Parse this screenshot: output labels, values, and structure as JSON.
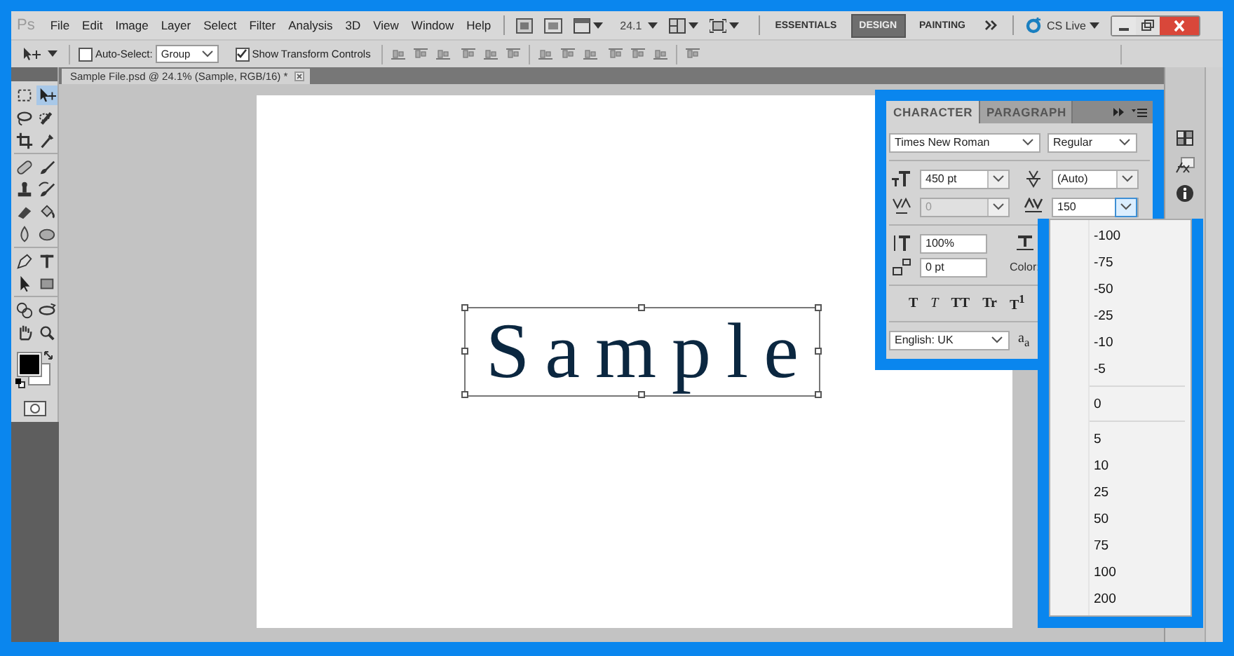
{
  "menu_bar": {
    "app_logo": "Ps",
    "items": [
      "File",
      "Edit",
      "Image",
      "Layer",
      "Select",
      "Filter",
      "Analysis",
      "3D",
      "View",
      "Window",
      "Help"
    ],
    "zoom": "24.1",
    "workspaces": [
      {
        "label": "ESSENTIALS",
        "selected": false
      },
      {
        "label": "DESIGN",
        "selected": true
      },
      {
        "label": "PAINTING",
        "selected": false
      }
    ],
    "cs_live": "CS Live"
  },
  "options_bar": {
    "auto_select": {
      "label": "Auto-Select:",
      "checked": false
    },
    "auto_select_mode": "Group",
    "show_transform": {
      "label": "Show Transform Controls",
      "checked": true
    }
  },
  "toolbox": {
    "tools": [
      {
        "kind": "marquee",
        "selected": false
      },
      {
        "kind": "move",
        "selected": true
      },
      {
        "kind": "lasso",
        "selected": false
      },
      {
        "kind": "quick_select",
        "selected": false
      },
      {
        "kind": "crop",
        "selected": false
      },
      {
        "kind": "eyedropper",
        "selected": false
      },
      {
        "kind": "bandage",
        "selected": false
      },
      {
        "kind": "brush",
        "selected": false
      },
      {
        "kind": "stamp",
        "selected": false
      },
      {
        "kind": "history_brush",
        "selected": false
      },
      {
        "kind": "eraser",
        "selected": false
      },
      {
        "kind": "bucket",
        "selected": false
      },
      {
        "kind": "drop",
        "selected": false
      },
      {
        "kind": "sponge",
        "selected": false
      },
      {
        "kind": "pen",
        "selected": false
      },
      {
        "kind": "type",
        "selected": false
      },
      {
        "kind": "pointer",
        "selected": false
      },
      {
        "kind": "rectangle",
        "selected": false
      },
      {
        "kind": "rotate",
        "selected": false
      },
      {
        "kind": "orbit",
        "selected": false
      },
      {
        "kind": "hand",
        "selected": false
      },
      {
        "kind": "zoom",
        "selected": false
      }
    ]
  },
  "document_tab": {
    "title": "Sample File.psd @ 24.1% (Sample, RGB/16) *"
  },
  "canvas": {
    "text": "Sample"
  },
  "character_panel": {
    "tabs": [
      {
        "label": "CHARACTER",
        "selected": true
      },
      {
        "label": "PARAGRAPH",
        "selected": false
      }
    ],
    "font_family": "Times New Roman",
    "font_style": "Regular",
    "font_size": {
      "value": "450 pt",
      "disabled": false
    },
    "leading": {
      "value": "(Auto)",
      "disabled": false
    },
    "kerning": {
      "value": "0",
      "disabled": true
    },
    "tracking": {
      "value": "150",
      "disabled": false
    },
    "vertical_scale": "100%",
    "baseline_shift": "0 pt",
    "color_label": "Color:",
    "type_styles": [
      {
        "label": "T",
        "kind": "bold"
      },
      {
        "label": "T",
        "kind": "italic"
      },
      {
        "label": "TT",
        "kind": "caps"
      },
      {
        "label": "Tr",
        "kind": "small_caps"
      },
      {
        "label": "T$^{1}$",
        "kind": "superscript"
      }
    ],
    "language": "English: UK",
    "anti_alias": "a$_{a}$"
  },
  "tracking_dropdown": {
    "items": [
      {
        "kind": "option",
        "label": "-100"
      },
      {
        "kind": "option",
        "label": "-75"
      },
      {
        "kind": "option",
        "label": "-50"
      },
      {
        "kind": "option",
        "label": "-25"
      },
      {
        "kind": "option",
        "label": "-10"
      },
      {
        "kind": "option",
        "label": "-5"
      },
      {
        "kind": "separator"
      },
      {
        "kind": "option",
        "label": "0"
      },
      {
        "kind": "separator"
      },
      {
        "kind": "option",
        "label": "5"
      },
      {
        "kind": "option",
        "label": "10"
      },
      {
        "kind": "option",
        "label": "25"
      },
      {
        "kind": "option",
        "label": "50"
      },
      {
        "kind": "option",
        "label": "75"
      },
      {
        "kind": "option",
        "label": "100"
      },
      {
        "kind": "option",
        "label": "200"
      }
    ]
  }
}
